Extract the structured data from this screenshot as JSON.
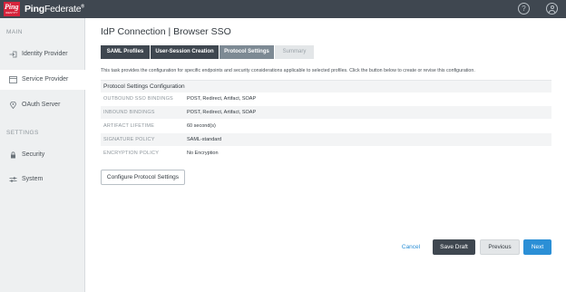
{
  "brand": {
    "logo_text": "Ping",
    "logo_subtext": "IDENTITY",
    "name_bold": "Ping",
    "name_light": "Federate",
    "trademark": "®"
  },
  "header": {
    "help_icon": "help-circle-icon",
    "help_glyph": "?",
    "user_icon": "user-avatar-icon"
  },
  "sidebar": {
    "sections": [
      {
        "title": "MAIN",
        "items": [
          {
            "label": "Identity Provider",
            "icon": "sign-in-icon",
            "active": false
          },
          {
            "label": "Service Provider",
            "icon": "window-icon",
            "active": true
          },
          {
            "label": "OAuth Server",
            "icon": "location-pin-icon",
            "active": false
          }
        ]
      },
      {
        "title": "SETTINGS",
        "items": [
          {
            "label": "Security",
            "icon": "lock-icon",
            "active": false
          },
          {
            "label": "System",
            "icon": "sliders-icon",
            "active": false
          }
        ]
      }
    ]
  },
  "page_title": "IdP Connection | Browser SSO",
  "tabs": [
    {
      "label": "SAML Profiles",
      "state": "completed"
    },
    {
      "label": "User-Session Creation",
      "state": "completed"
    },
    {
      "label": "Protocol Settings",
      "state": "current"
    },
    {
      "label": "Summary",
      "state": "upcoming"
    }
  ],
  "description": "This task provides the configuration for specific endpoints and security considerations applicable to selected profiles. Click the button below to create or revise this configuration.",
  "config_section": {
    "title": "Protocol Settings Configuration",
    "rows": [
      {
        "key": "OUTBOUND SSO BINDINGS",
        "value": "POST, Redirect, Artifact, SOAP"
      },
      {
        "key": "INBOUND BINDINGS",
        "value": "POST, Redirect, Artifact, SOAP"
      },
      {
        "key": "ARTIFACT LIFETIME",
        "value": "60 second(s)"
      },
      {
        "key": "SIGNATURE POLICY",
        "value": "SAML-standard"
      },
      {
        "key": "ENCRYPTION POLICY",
        "value": "No Encryption"
      }
    ]
  },
  "buttons": {
    "configure": "Configure Protocol Settings",
    "cancel": "Cancel",
    "save_draft": "Save Draft",
    "previous": "Previous",
    "next": "Next"
  },
  "colors": {
    "topbar": "#3f4750",
    "logo": "#d6243c",
    "primary": "#2b8fd6",
    "tab_current": "#7d8a94"
  }
}
